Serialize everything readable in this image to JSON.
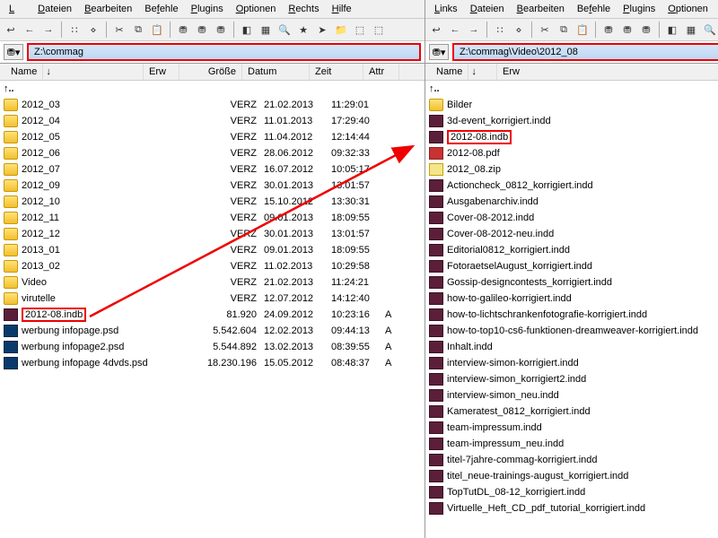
{
  "menu": {
    "links": "Links",
    "dateien": "Dateien",
    "bearbeiten": "Bearbeiten",
    "befehle": "Befehle",
    "plugins": "Plugins",
    "optionen": "Optionen",
    "rechts": "Rechts",
    "hilfe": "Hilfe"
  },
  "left": {
    "path": "Z:\\commag",
    "headers": {
      "name": "Name",
      "ext": "Erw",
      "size": "Größe",
      "date": "Datum",
      "time": "Zeit",
      "attr": "Attr"
    },
    "updir": "↑..",
    "rows": [
      {
        "icon": "folder",
        "name": "2012_03",
        "ext": "",
        "size": "VERZ",
        "date": "21.02.2013",
        "time": "11:29:01",
        "attr": ""
      },
      {
        "icon": "folder",
        "name": "2012_04",
        "ext": "",
        "size": "VERZ",
        "date": "11.01.2013",
        "time": "17:29:40",
        "attr": ""
      },
      {
        "icon": "folder",
        "name": "2012_05",
        "ext": "",
        "size": "VERZ",
        "date": "11.04.2012",
        "time": "12:14:44",
        "attr": ""
      },
      {
        "icon": "folder",
        "name": "2012_06",
        "ext": "",
        "size": "VERZ",
        "date": "28.06.2012",
        "time": "09:32:33",
        "attr": ""
      },
      {
        "icon": "folder",
        "name": "2012_07",
        "ext": "",
        "size": "VERZ",
        "date": "16.07.2012",
        "time": "10:05:17",
        "attr": ""
      },
      {
        "icon": "folder",
        "name": "2012_09",
        "ext": "",
        "size": "VERZ",
        "date": "30.01.2013",
        "time": "13:01:57",
        "attr": ""
      },
      {
        "icon": "folder",
        "name": "2012_10",
        "ext": "",
        "size": "VERZ",
        "date": "15.10.2012",
        "time": "13:30:31",
        "attr": ""
      },
      {
        "icon": "folder",
        "name": "2012_11",
        "ext": "",
        "size": "VERZ",
        "date": "09.01.2013",
        "time": "18:09:55",
        "attr": ""
      },
      {
        "icon": "folder",
        "name": "2012_12",
        "ext": "",
        "size": "VERZ",
        "date": "30.01.2013",
        "time": "13:01:57",
        "attr": ""
      },
      {
        "icon": "folder",
        "name": "2013_01",
        "ext": "",
        "size": "VERZ",
        "date": "09.01.2013",
        "time": "18:09:55",
        "attr": ""
      },
      {
        "icon": "folder",
        "name": "2013_02",
        "ext": "",
        "size": "VERZ",
        "date": "11.02.2013",
        "time": "10:29:58",
        "attr": ""
      },
      {
        "icon": "folder",
        "name": "Video",
        "ext": "",
        "size": "VERZ",
        "date": "21.02.2013",
        "time": "11:24:21",
        "attr": ""
      },
      {
        "icon": "folder",
        "name": "virutelle",
        "ext": "",
        "size": "VERZ",
        "date": "12.07.2012",
        "time": "14:12:40",
        "attr": ""
      },
      {
        "icon": "indd",
        "name": "2012-08.indb",
        "ext": "",
        "size": "81.920",
        "date": "24.09.2012",
        "time": "10:23:16",
        "attr": "A",
        "boxed": true
      },
      {
        "icon": "psd",
        "name": "werbung infopage.psd",
        "ext": "",
        "size": "5.542.604",
        "date": "12.02.2013",
        "time": "09:44:13",
        "attr": "A"
      },
      {
        "icon": "psd",
        "name": "werbung infopage2.psd",
        "ext": "",
        "size": "5.544.892",
        "date": "13.02.2013",
        "time": "08:39:55",
        "attr": "A"
      },
      {
        "icon": "psd",
        "name": "werbung infopage 4dvds.psd",
        "ext": "",
        "size": "18.230.196",
        "date": "15.05.2012",
        "time": "08:48:37",
        "attr": "A"
      }
    ]
  },
  "right": {
    "path": "Z:\\commag\\Video\\2012_08",
    "headers": {
      "name": "Name",
      "ext": "Erw"
    },
    "updir": "↑..",
    "rows": [
      {
        "icon": "folder",
        "name": "Bilder"
      },
      {
        "icon": "indd",
        "name": "3d-event_korrigiert.indd"
      },
      {
        "icon": "indd",
        "name": "2012-08.indb",
        "boxed": true
      },
      {
        "icon": "pdf",
        "name": "2012-08.pdf"
      },
      {
        "icon": "zip",
        "name": "2012_08.zip"
      },
      {
        "icon": "indd",
        "name": "Actioncheck_0812_korrigiert.indd"
      },
      {
        "icon": "indd",
        "name": "Ausgabenarchiv.indd"
      },
      {
        "icon": "indd",
        "name": "Cover-08-2012.indd"
      },
      {
        "icon": "indd",
        "name": "Cover-08-2012-neu.indd"
      },
      {
        "icon": "indd",
        "name": "Editorial0812_korrigiert.indd"
      },
      {
        "icon": "indd",
        "name": "FotoraetselAugust_korrigiert.indd"
      },
      {
        "icon": "indd",
        "name": "Gossip-designcontests_korrigiert.indd"
      },
      {
        "icon": "indd",
        "name": "how-to-galileo-korrigiert.indd"
      },
      {
        "icon": "indd",
        "name": "how-to-lichtschrankenfotografie-korrigiert.indd"
      },
      {
        "icon": "indd",
        "name": "how-to-top10-cs6-funktionen-dreamweaver-korrigiert.indd"
      },
      {
        "icon": "indd",
        "name": "Inhalt.indd"
      },
      {
        "icon": "indd",
        "name": "interview-simon-korrigiert.indd"
      },
      {
        "icon": "indd",
        "name": "interview-simon_korrigiert2.indd"
      },
      {
        "icon": "indd",
        "name": "interview-simon_neu.indd"
      },
      {
        "icon": "indd",
        "name": "Kameratest_0812_korrigiert.indd"
      },
      {
        "icon": "indd",
        "name": "team-impressum.indd"
      },
      {
        "icon": "indd",
        "name": "team-impressum_neu.indd"
      },
      {
        "icon": "indd",
        "name": "titel-7jahre-commag-korrigiert.indd"
      },
      {
        "icon": "indd",
        "name": "titel_neue-trainings-august_korrigiert.indd"
      },
      {
        "icon": "indd",
        "name": "TopTutDL_08-12_korrigiert.indd"
      },
      {
        "icon": "indd",
        "name": "Virtuelle_Heft_CD_pdf_tutorial_korrigiert.indd"
      }
    ]
  }
}
